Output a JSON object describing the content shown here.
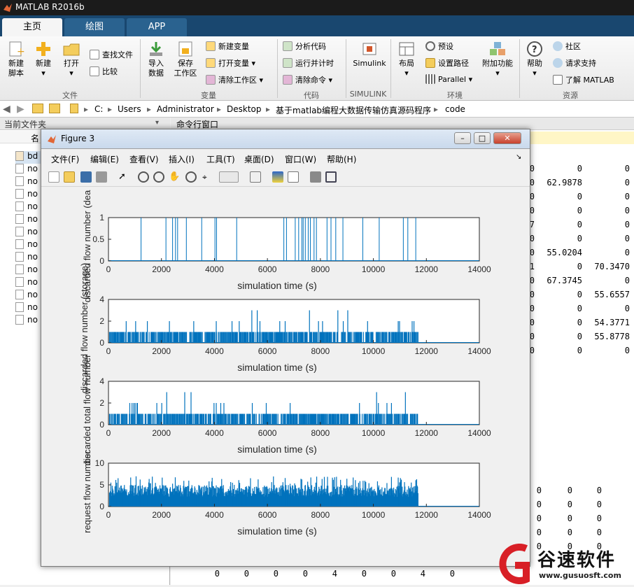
{
  "app": {
    "title": "MATLAB R2016b"
  },
  "tabs": [
    "主页",
    "绘图",
    "APP"
  ],
  "ribbon": {
    "new_script": "新建\n脚本",
    "new": "新建",
    "open": "打开",
    "find_files": "查找文件",
    "compare": "比较",
    "import_data": "导入\n数据",
    "save_workspace": "保存\n工作区",
    "new_variable": "新建变量",
    "open_variable": "打开变量",
    "clear_workspace": "清除工作区",
    "analyze_code": "分析代码",
    "run_and_time": "运行并计时",
    "clear_commands": "清除命令",
    "simulink": "Simulink",
    "layout": "布局",
    "preferences": "预设",
    "set_path": "设置路径",
    "parallel": "Parallel",
    "addons": "附加功能",
    "help": "帮助",
    "community": "社区",
    "request_support": "请求支持",
    "learn_matlab": "了解 MATLAB",
    "groups": [
      "文件",
      "变量",
      "代码",
      "SIMULINK",
      "环境",
      "资源"
    ]
  },
  "address": {
    "path": [
      "C:",
      "Users",
      "Administrator",
      "Desktop",
      "基于matlab编程大数据传输仿真源码程序",
      "code"
    ]
  },
  "left_panel": {
    "title": "当前文件夹",
    "name_header": "名",
    "files": [
      "bd",
      "no",
      "no",
      "no",
      "no",
      "no",
      "no",
      "no",
      "no",
      "no",
      "no",
      "no",
      "no",
      "no"
    ]
  },
  "command_window": {
    "title": "命令行窗口",
    "rows": [
      [
        "0",
        "0",
        "0"
      ],
      [
        "0",
        "62.9878",
        "0"
      ],
      [
        "0",
        "0",
        "0"
      ],
      [
        "0",
        "0",
        "0"
      ],
      [
        "7",
        "0",
        "0"
      ],
      [
        "0",
        "0",
        "0"
      ],
      [
        "0",
        "55.0204",
        "0"
      ],
      [
        "1",
        "0",
        "70.3470"
      ],
      [
        "0",
        "67.3745",
        "0"
      ],
      [
        "0",
        "0",
        "55.6557"
      ],
      [
        "0",
        "0",
        "0"
      ],
      [
        "0",
        "0",
        "54.3771"
      ],
      [
        "0",
        "0",
        "55.8778"
      ],
      [
        "0",
        "0",
        "0"
      ]
    ],
    "lower_rows": [
      [
        "0",
        "0",
        "0"
      ],
      [
        "0",
        "0",
        "0"
      ],
      [
        "0",
        "0",
        "0"
      ],
      [
        "0",
        "0",
        "0"
      ],
      [
        "0",
        "0",
        "0"
      ]
    ],
    "bottom_row": [
      "0",
      "0",
      "0",
      "0",
      "4",
      "0",
      "0",
      "4",
      "0"
    ]
  },
  "figure": {
    "title": "Figure 3",
    "menus": [
      "文件(F)",
      "编辑(E)",
      "查看(V)",
      "插入(I)",
      "工具(T)",
      "桌面(D)",
      "窗口(W)",
      "帮助(H)"
    ],
    "win_buttons": [
      "–",
      "□",
      "✕"
    ]
  },
  "watermark": {
    "brand": "谷速软件",
    "url": "www.gusuosft.com"
  },
  "colors": {
    "plot_blue": "#0072bd",
    "tab_bar": "#19476f",
    "title_bar": "#1b1b1b"
  },
  "chart_data": [
    {
      "type": "bar",
      "title": "",
      "xlabel": "simulation time (s)",
      "ylabel": "discarded flow number (dea",
      "xlim": [
        0,
        14000
      ],
      "ylim": [
        0,
        1
      ],
      "yticks": [
        0,
        0.5,
        1
      ],
      "xticks": [
        0,
        2000,
        4000,
        6000,
        8000,
        10000,
        12000,
        14000
      ],
      "x": [
        1230,
        2170,
        2420,
        2530,
        2610,
        2940,
        3520,
        4020,
        4080,
        4840,
        6620,
        6720,
        7050,
        7180,
        7300,
        7350,
        7430,
        7540,
        7620,
        7760,
        7850,
        8250,
        8400,
        8580,
        8850,
        9600,
        10220,
        11130,
        11300,
        11600
      ],
      "values": [
        1,
        1,
        1,
        1,
        1,
        1,
        1,
        1,
        1,
        1,
        1,
        1,
        1,
        1,
        1,
        1,
        1,
        1,
        1,
        1,
        1,
        1,
        1,
        1,
        1,
        1,
        1,
        1,
        1,
        1
      ],
      "active_until": 11800
    },
    {
      "type": "bar",
      "title": "",
      "xlabel": "simulation time (s)",
      "ylabel": "discarded flow number (storage)",
      "xlim": [
        0,
        14000
      ],
      "ylim": [
        0,
        4
      ],
      "yticks": [
        0,
        2,
        4
      ],
      "xticks": [
        0,
        2000,
        4000,
        6000,
        8000,
        10000,
        12000,
        14000
      ],
      "typical_max": 1,
      "max": 3,
      "active_until": 11700
    },
    {
      "type": "bar",
      "title": "",
      "xlabel": "simulation time (s)",
      "ylabel": "discarded total flow number",
      "xlim": [
        0,
        14000
      ],
      "ylim": [
        0,
        4
      ],
      "yticks": [
        0,
        2,
        4
      ],
      "xticks": [
        0,
        2000,
        4000,
        6000,
        8000,
        10000,
        12000,
        14000
      ],
      "typical_max": 1,
      "max": 3,
      "active_until": 11700
    },
    {
      "type": "bar",
      "title": "",
      "xlabel": "simulation time (s)",
      "ylabel": "request flow number",
      "xlim": [
        0,
        14000
      ],
      "ylim": [
        0,
        10
      ],
      "yticks": [
        0,
        5,
        10
      ],
      "xticks": [
        0,
        2000,
        4000,
        6000,
        8000,
        10000,
        12000,
        14000
      ],
      "typical_max": 5,
      "max": 7,
      "active_until": 11700
    }
  ]
}
